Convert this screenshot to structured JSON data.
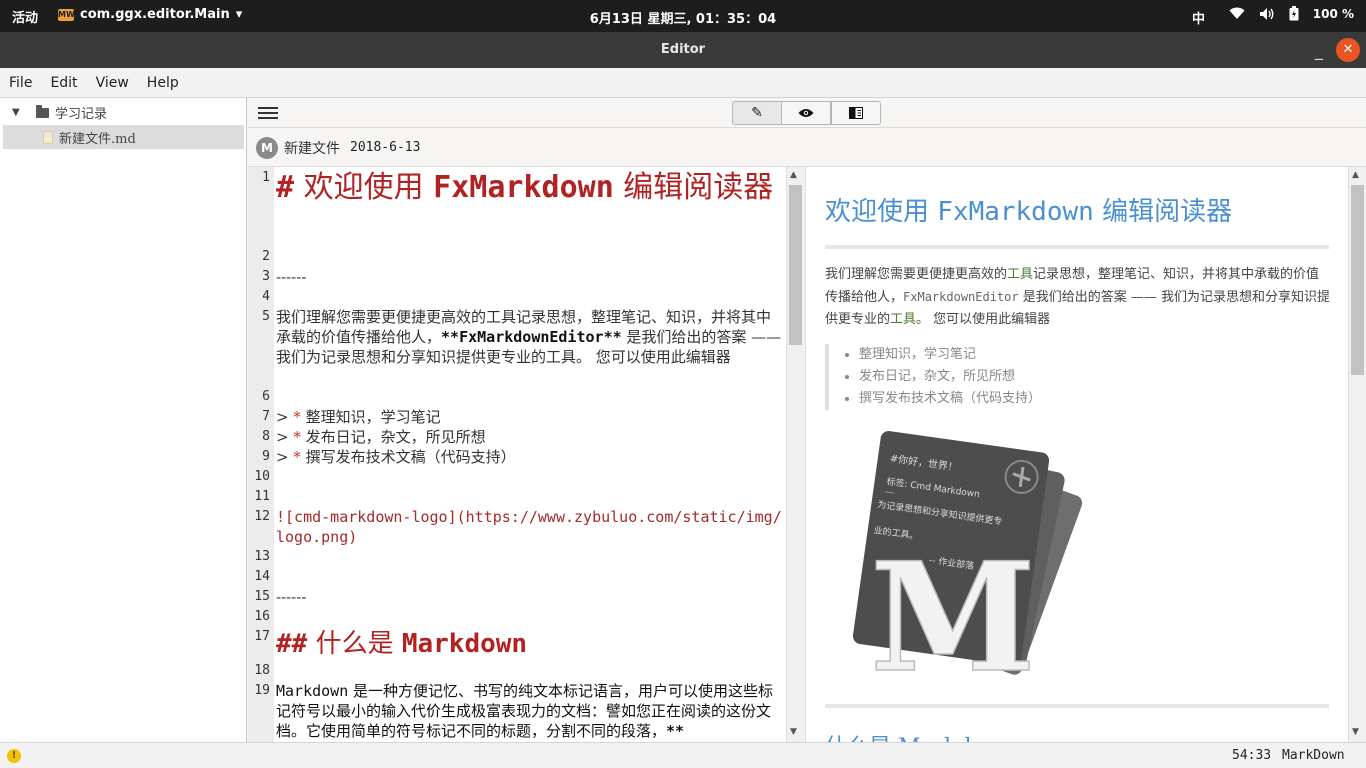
{
  "topbar": {
    "activities": "活动",
    "app_icon": "MW",
    "app_name": "com.ggx.editor.Main",
    "clock": "6月13日 星期三, 01：35：04",
    "input_method": "中",
    "battery": "100 %"
  },
  "window": {
    "title": "Editor",
    "minimize_glyph": "_",
    "close_glyph": "✕"
  },
  "menu": {
    "file": "File",
    "edit": "Edit",
    "view": "View",
    "help": "Help"
  },
  "sidebar": {
    "folder_name": "学习记录",
    "file_name": "新建文件.md"
  },
  "toolbar": {
    "edit_icon": "✎",
    "preview_icon": "👁",
    "split_icon": "◧"
  },
  "doc": {
    "avatar": "M",
    "name": "新建文件",
    "date": "2018-6-13"
  },
  "editor": {
    "line_numbers": [
      "1",
      "2",
      "3",
      "4",
      "5",
      "6",
      "7",
      "8",
      "9",
      "10",
      "11",
      "12",
      "13",
      "14",
      "15",
      "16",
      "17",
      "18",
      "19"
    ],
    "l1_hash": "#",
    "l1_text_a": " 欢迎使用 ",
    "l1_bold": "FxMarkdown",
    "l1_text_b": " 编辑阅读器",
    "l3": "------",
    "l5_a": "我们理解您需要更便捷更高效的工具记录思想，整理笔记、知识，并将其中承载的价值传播给他人，",
    "l5_b": "**FxMarkdownEditor**",
    "l5_c": " 是我们给出的答案 —— 我们为记录思想和分享知识提供更专业的工具。 您可以使用此编辑器",
    "quote_mark": ">",
    "bullet_mark": "*",
    "l7": " 整理知识，学习笔记",
    "l8": " 发布日记，杂文，所见所想",
    "l9": " 撰写发布技术文稿（代码支持）",
    "l12": "![cmd-markdown-logo](https://www.zybuluo.com/static/img/logo.png)",
    "l15": "------",
    "l17_hash": "##",
    "l17_text": " 什么是 ",
    "l17_bold": "Markdown",
    "l19_a": "Markdown",
    "l19_b": " 是一种方便记忆、书写的纯文本标记语言，用户可以使用这些标记符号以最小的输入代价生成极富表现力的文档：譬如您正在阅读的这份文档。它使用简单的符号标记不同的标题，分割不同的段落，",
    "l19_c": "**"
  },
  "preview": {
    "title_a": "欢迎使用 ",
    "title_b": "FxMarkdown",
    "title_c": " 编辑阅读器",
    "para_a": "我们理解您需要更便捷更高效的",
    "para_g1": "工具",
    "para_b": "记录思想，整理笔记、知识，并将其中承载的价值传播给他人，",
    "para_mono": "FxMarkdownEditor",
    "para_c": " 是我们给出的答案 —— 我们为记录思想和分享知识提供更专业的",
    "para_g2": "工具",
    "para_d": "。 您可以使用此编辑器",
    "bullets": [
      "整理知识，学习笔记",
      "发布日记，杂文，所见所想",
      "撰写发布技术文稿（代码支持）"
    ],
    "logo": {
      "card_title": "#你好，世界！",
      "card_tag": "标签: Cmd Markdown",
      "card_dash": "---",
      "card_body_1": "为记录思想和分享知识提供更专",
      "card_body_2": "业的工具。",
      "card_sign": "-- 作业部落",
      "letter": "M"
    },
    "next_heading": "什么是 Markdown"
  },
  "status": {
    "warn_glyph": "!",
    "position": "54:33",
    "mode": "MarkDown"
  }
}
